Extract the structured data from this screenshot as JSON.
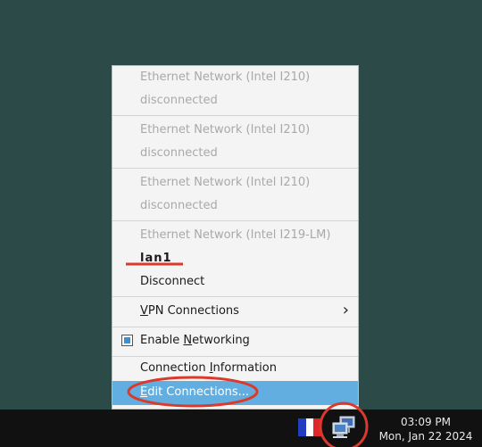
{
  "menu": {
    "adapters": [
      {
        "name": "Ethernet Network (Intel I210)",
        "status": "disconnected"
      },
      {
        "name": "Ethernet Network (Intel I210)",
        "status": "disconnected"
      },
      {
        "name": "Ethernet Network (Intel I210)",
        "status": "disconnected"
      }
    ],
    "active_adapter": {
      "name": "Ethernet Network (Intel I219-LM)",
      "connection": "lan1",
      "action": "Disconnect"
    },
    "vpn_label": "VPN Connections",
    "enable_networking_label": "Enable Networking",
    "enable_networking_checked": true,
    "connection_info_label": "Connection Information",
    "edit_connections_label": "Edit Connections..."
  },
  "taskbar": {
    "time": "03:09 PM",
    "date": "Mon, Jan 22 2024",
    "flag_colors": [
      "#1f3fbf",
      "#ffffff",
      "#e0262a"
    ],
    "network_icon": "network-manager-icon"
  },
  "colors": {
    "desktop": "#2c4a48",
    "highlight": "#62aee0",
    "annotation": "#d93a2b"
  }
}
